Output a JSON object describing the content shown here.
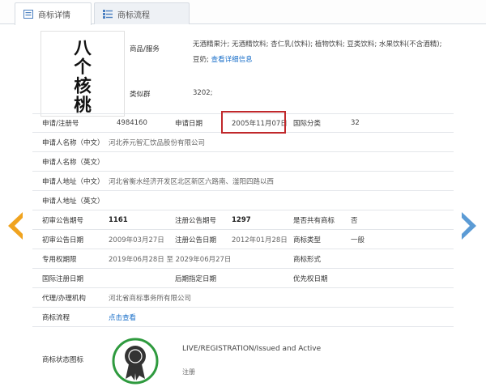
{
  "tabs": [
    {
      "label": "商标详情",
      "icon": "list-icon",
      "active": true
    },
    {
      "label": "商标流程",
      "icon": "flow-icon",
      "active": false
    }
  ],
  "mark": {
    "image_text": [
      "八",
      "个",
      "核",
      "桃"
    ]
  },
  "goods": {
    "label": "商品/服务",
    "text": "无酒精果汁; 无酒精饮料; 杏仁乳(饮料); 植物饮料; 豆类饮料; 水果饮料(不含酒精); 豆奶;",
    "link": "查看详细信息"
  },
  "similar": {
    "label": "类似群",
    "value": "3202;"
  },
  "fields": {
    "app_no_label": "申请/注册号",
    "app_no": "4984160",
    "app_date_label": "申请日期",
    "app_date": "2005年11月07日",
    "intl_class_label": "国际分类",
    "intl_class": "32",
    "applicant_cn_label": "申请人名称（中文）",
    "applicant_cn": "河北养元智汇饮品股份有限公司",
    "applicant_en_label": "申请人名称（英文）",
    "address_cn_label": "申请人地址（中文）",
    "address_cn": "河北省衡水经济开发区北区新区六路南、滏阳四路以西",
    "address_en_label": "申请人地址（英文）",
    "prelim_issue_label": "初审公告期号",
    "prelim_issue": "1161",
    "reg_issue_label": "注册公告期号",
    "reg_issue": "1297",
    "shared_label": "是否共有商标",
    "shared": "否",
    "prelim_date_label": "初审公告日期",
    "prelim_date": "2009年03月27日",
    "reg_date_label": "注册公告日期",
    "reg_date": "2012年01月28日",
    "mark_type_label": "商标类型",
    "mark_type": "一般",
    "exclusive_label": "专用权期限",
    "exclusive": "2019年06月28日 至 2029年06月27日",
    "mark_form_label": "商标形式",
    "intl_reg_date_label": "国际注册日期",
    "later_date_label": "后期指定日期",
    "priority_date_label": "优先权日期",
    "agent_label": "代理/办理机构",
    "agent": "河北省商标事务所有限公司",
    "process_label": "商标流程",
    "process_link": "点击查看",
    "status_label": "商标状态图标"
  },
  "status": {
    "en": "LIVE/REGISTRATION/Issued and Active",
    "cn": "注册"
  },
  "colors": {
    "accent": "#1a6fc9",
    "highlight": "#c0282b",
    "left_arrow": "#f0a31f",
    "right_arrow": "#5b9bd5",
    "seal_ring": "#2e9a3e"
  }
}
